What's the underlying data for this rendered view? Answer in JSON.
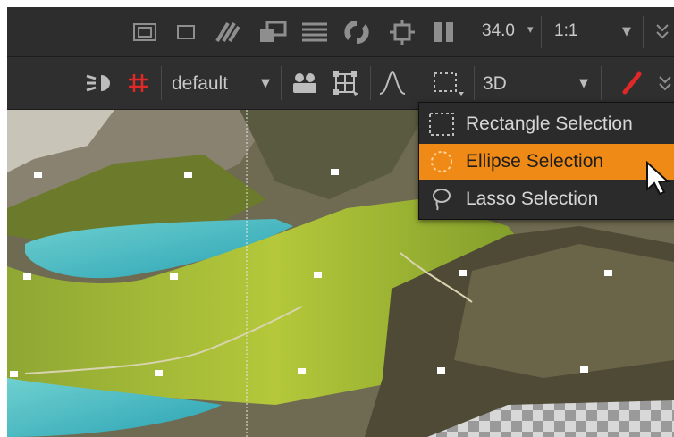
{
  "top_toolbar": {
    "icons": [
      "frame-icon",
      "square-icon",
      "hatch-icon",
      "overlay-icon",
      "list-icon",
      "sync-icon",
      "crosshair-icon",
      "pause-icon"
    ],
    "fstop_value": "34.0",
    "ratio_value": "1:1",
    "more_icon": "double-chevron-icon"
  },
  "viewer_toolbar": {
    "icons": [
      "eye-icon",
      "grid-icon"
    ],
    "display_value": "default",
    "mode_value": "3D"
  },
  "selection_menu": {
    "items": [
      {
        "label": "Rectangle Selection",
        "icon": "rectangle-selection-icon",
        "active": false
      },
      {
        "label": "Ellipse Selection",
        "icon": "ellipse-selection-icon",
        "active": true
      },
      {
        "label": "Lasso Selection",
        "icon": "lasso-icon",
        "active": false
      }
    ]
  },
  "colors": {
    "toolbar_bg": "#2d2d2d",
    "accent_orange": "#f08a16",
    "red_accent": "#e02828"
  }
}
